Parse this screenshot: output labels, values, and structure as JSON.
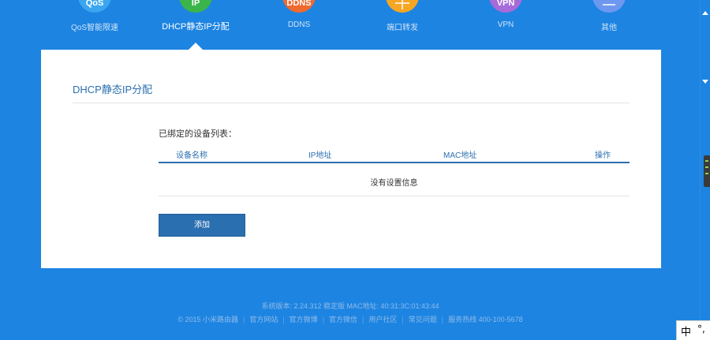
{
  "nav": {
    "items": [
      {
        "label": "QoS智能限速",
        "icon_text": "QoS",
        "color": "#3aa6ef"
      },
      {
        "label": "DHCP静态IP分配",
        "icon_text": "IP",
        "color": "#3bb54a",
        "active": true
      },
      {
        "label": "DDNS",
        "icon_text": "DDNS",
        "color": "#ef6a2f"
      },
      {
        "label": "端口转发",
        "icon_text": "",
        "color": "#f6a623"
      },
      {
        "label": "VPN",
        "icon_text": "VPN",
        "color": "#a66bd9"
      },
      {
        "label": "其他",
        "icon_text": "",
        "color": "#6e98f0"
      }
    ]
  },
  "card": {
    "title": "DHCP静态IP分配",
    "list_title": "已绑定的设备列表：",
    "columns": [
      "设备名称",
      "IP地址",
      "MAC地址",
      "操作"
    ],
    "empty_text": "没有设置信息",
    "add_button": "添加"
  },
  "footer": {
    "line1": "系统版本: 2.24.312 稳定版   MAC地址: 40:31:3C:01:43:44",
    "links": [
      "© 2015 小米路由器",
      "官方网站",
      "官方微博",
      "官方微信",
      "用户社区",
      "常见问题",
      "服务热线 400-100-5678"
    ]
  },
  "ime": {
    "mode": "中",
    "punct": "°,"
  }
}
